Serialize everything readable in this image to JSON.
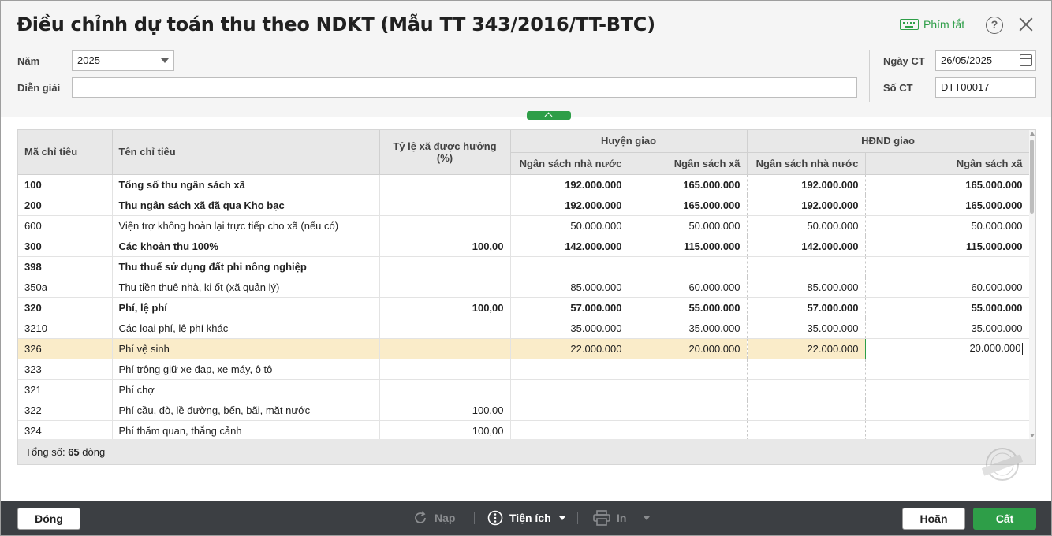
{
  "title": "Điều chỉnh dự toán thu theo NDKT (Mẫu TT 343/2016/TT-BTC)",
  "shortcut_label": "Phím tắt",
  "help_glyph": "?",
  "form": {
    "year_label": "Năm",
    "year_value": "2025",
    "description_label": "Diễn giải",
    "description_value": "",
    "date_label": "Ngày CT",
    "date_value": "26/05/2025",
    "doc_no_label": "Số CT",
    "doc_no_value": "DTT00017"
  },
  "grid": {
    "headers": {
      "code": "Mã chỉ tiêu",
      "name": "Tên chỉ tiêu",
      "rate": "Tỷ lệ xã được hưởng (%)",
      "group_district": "Huyện giao",
      "group_council": "HĐND giao",
      "state_budget": "Ngân sách nhà nước",
      "commune_budget": "Ngân sách xã"
    },
    "rows": [
      {
        "code": "100",
        "name": "Tổng số thu ngân sách xã",
        "rate": "",
        "d_state": "192.000.000",
        "d_commune": "165.000.000",
        "c_state": "192.000.000",
        "c_commune": "165.000.000",
        "bold": true
      },
      {
        "code": "200",
        "name": "Thu ngân sách xã đã qua Kho bạc",
        "rate": "",
        "d_state": "192.000.000",
        "d_commune": "165.000.000",
        "c_state": "192.000.000",
        "c_commune": "165.000.000",
        "bold": true
      },
      {
        "code": "600",
        "name": "Viện trợ không hoàn lại trực tiếp cho xã (nếu có)",
        "rate": "",
        "d_state": "50.000.000",
        "d_commune": "50.000.000",
        "c_state": "50.000.000",
        "c_commune": "50.000.000",
        "bold": false
      },
      {
        "code": "300",
        "name": "Các khoản thu 100%",
        "rate": "100,00",
        "d_state": "142.000.000",
        "d_commune": "115.000.000",
        "c_state": "142.000.000",
        "c_commune": "115.000.000",
        "bold": true
      },
      {
        "code": "398",
        "name": "Thu thuế sử dụng đất phi nông nghiệp",
        "rate": "",
        "d_state": "",
        "d_commune": "",
        "c_state": "",
        "c_commune": "",
        "bold": true
      },
      {
        "code": "350a",
        "name": "Thu tiền thuê nhà, ki ốt (xã quản lý)",
        "rate": "",
        "d_state": "85.000.000",
        "d_commune": "60.000.000",
        "c_state": "85.000.000",
        "c_commune": "60.000.000",
        "bold": false
      },
      {
        "code": "320",
        "name": "Phí, lệ phí",
        "rate": "100,00",
        "d_state": "57.000.000",
        "d_commune": "55.000.000",
        "c_state": "57.000.000",
        "c_commune": "55.000.000",
        "bold": true
      },
      {
        "code": "3210",
        "name": "Các loại phí, lệ phí khác",
        "rate": "",
        "d_state": "35.000.000",
        "d_commune": "35.000.000",
        "c_state": "35.000.000",
        "c_commune": "35.000.000",
        "bold": false
      },
      {
        "code": "326",
        "name": "Phí vệ sinh",
        "rate": "",
        "d_state": "22.000.000",
        "d_commune": "20.000.000",
        "c_state": "22.000.000",
        "c_commune": "20.000.000",
        "bold": false,
        "selected": true
      },
      {
        "code": "323",
        "name": "Phí trông giữ xe đạp, xe máy, ô tô",
        "rate": "",
        "d_state": "",
        "d_commune": "",
        "c_state": "",
        "c_commune": "",
        "bold": false
      },
      {
        "code": "321",
        "name": "Phí chợ",
        "rate": "",
        "d_state": "",
        "d_commune": "",
        "c_state": "",
        "c_commune": "",
        "bold": false
      },
      {
        "code": "322",
        "name": "Phí cầu, đò, lề đường, bến, bãi, mặt nước",
        "rate": "100,00",
        "d_state": "",
        "d_commune": "",
        "c_state": "",
        "c_commune": "",
        "bold": false
      },
      {
        "code": "324",
        "name": "Phí thăm quan, thắng cảnh",
        "rate": "100,00",
        "d_state": "",
        "d_commune": "",
        "c_state": "",
        "c_commune": "",
        "bold": false
      }
    ],
    "total_prefix": "Tổng số: ",
    "total_count": "65",
    "total_suffix": " dòng"
  },
  "toolbar": {
    "close_label": "Đóng",
    "reload_label": "Nạp",
    "utilities_label": "Tiện ích",
    "print_label": "In",
    "cancel_label": "Hoãn",
    "save_label": "Cất"
  },
  "colors": {
    "accent": "#2e9e48",
    "selected_row": "#faecc9",
    "bottom_bar": "#3c3f43"
  }
}
